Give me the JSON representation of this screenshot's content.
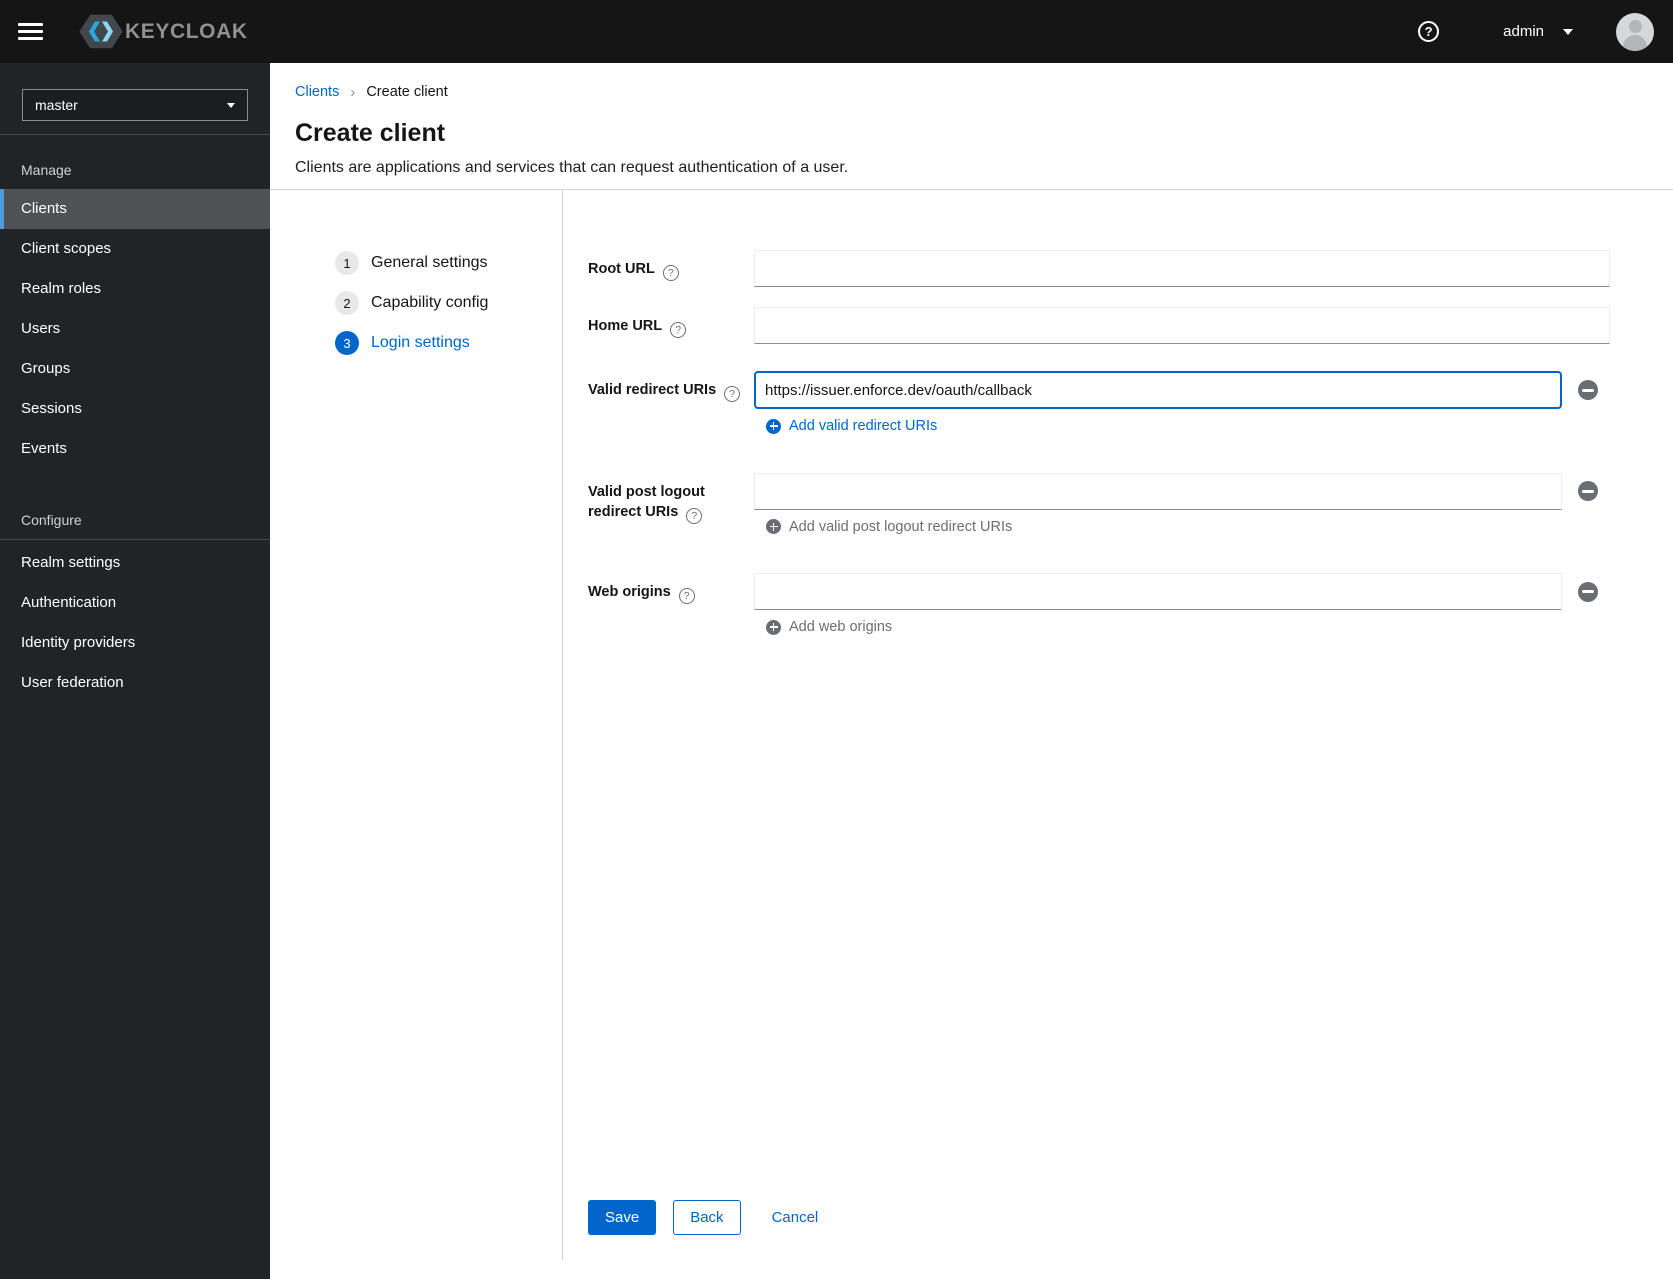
{
  "colors": {
    "accent": "#0066cc",
    "header_bg": "#151515",
    "sidebar_bg": "#212427",
    "sidebar_active_bg": "#4f5255",
    "sidebar_active_border": "#4f9cd9",
    "muted": "#6a6e73",
    "divider": "#d2d2d2",
    "input_border": "#ededed",
    "input_border_bottom": "#8a8d90"
  },
  "icons": {
    "help": "?",
    "breadcrumb_separator": "›"
  },
  "header": {
    "brand": "KEYCLOAK",
    "username": "admin"
  },
  "sidebar": {
    "realm": "master",
    "active_item": "Clients",
    "manage": {
      "label": "Manage",
      "items": [
        "Clients",
        "Client scopes",
        "Realm roles",
        "Users",
        "Groups",
        "Sessions",
        "Events"
      ]
    },
    "configure": {
      "label": "Configure",
      "items": [
        "Realm settings",
        "Authentication",
        "Identity providers",
        "User federation"
      ]
    }
  },
  "breadcrumb": {
    "link": "Clients",
    "current": "Create client"
  },
  "page": {
    "title": "Create client",
    "subtitle": "Clients are applications and services that can request authentication of a user."
  },
  "wizard": {
    "steps": [
      {
        "num": "1",
        "label": "General settings",
        "current": false
      },
      {
        "num": "2",
        "label": "Capability config",
        "current": false
      },
      {
        "num": "3",
        "label": "Login settings",
        "current": true
      }
    ]
  },
  "form": {
    "root_url": {
      "label": "Root URL",
      "value": ""
    },
    "home_url": {
      "label": "Home URL",
      "value": ""
    },
    "valid_redirect_uris": {
      "label": "Valid redirect URIs",
      "value": "https://issuer.enforce.dev/oauth/callback",
      "add_label": "Add valid redirect URIs",
      "add_enabled": true
    },
    "valid_post_logout_redirect_uris": {
      "label": "Valid post logout redirect URIs",
      "value": "",
      "add_label": "Add valid post logout redirect URIs",
      "add_enabled": false
    },
    "web_origins": {
      "label": "Web origins",
      "value": "",
      "add_label": "Add web origins",
      "add_enabled": false
    }
  },
  "footer": {
    "save": "Save",
    "back": "Back",
    "cancel": "Cancel"
  }
}
